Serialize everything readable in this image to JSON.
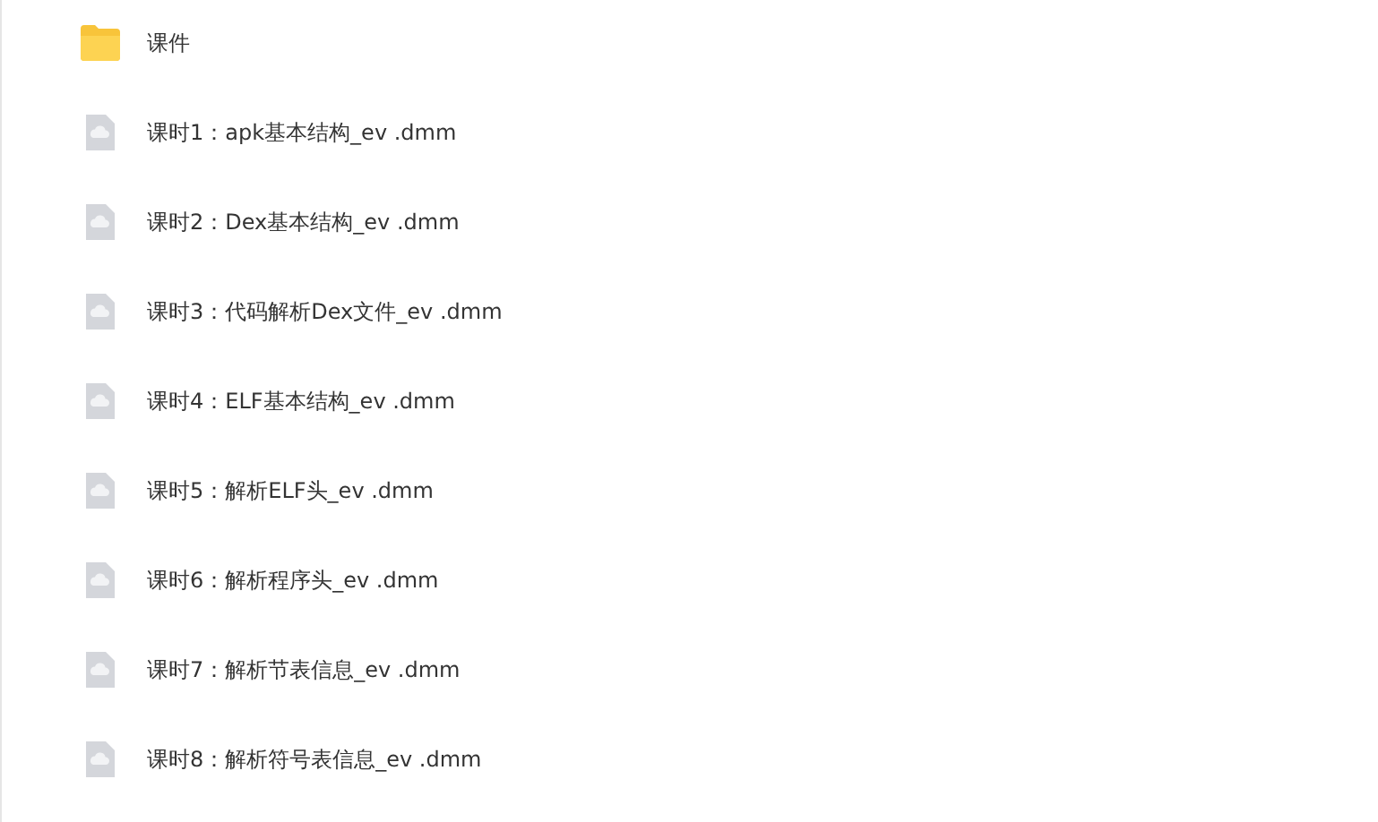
{
  "files": [
    {
      "kind": "folder",
      "name": "课件"
    },
    {
      "kind": "file",
      "name": "课时1：apk基本结构_ev .dmm"
    },
    {
      "kind": "file",
      "name": "课时2：Dex基本结构_ev .dmm"
    },
    {
      "kind": "file",
      "name": "课时3：代码解析Dex文件_ev .dmm"
    },
    {
      "kind": "file",
      "name": "课时4：ELF基本结构_ev .dmm"
    },
    {
      "kind": "file",
      "name": "课时5：解析ELF头_ev .dmm"
    },
    {
      "kind": "file",
      "name": "课时6：解析程序头_ev .dmm"
    },
    {
      "kind": "file",
      "name": "课时7：解析节表信息_ev .dmm"
    },
    {
      "kind": "file",
      "name": "课时8：解析符号表信息_ev .dmm"
    }
  ]
}
